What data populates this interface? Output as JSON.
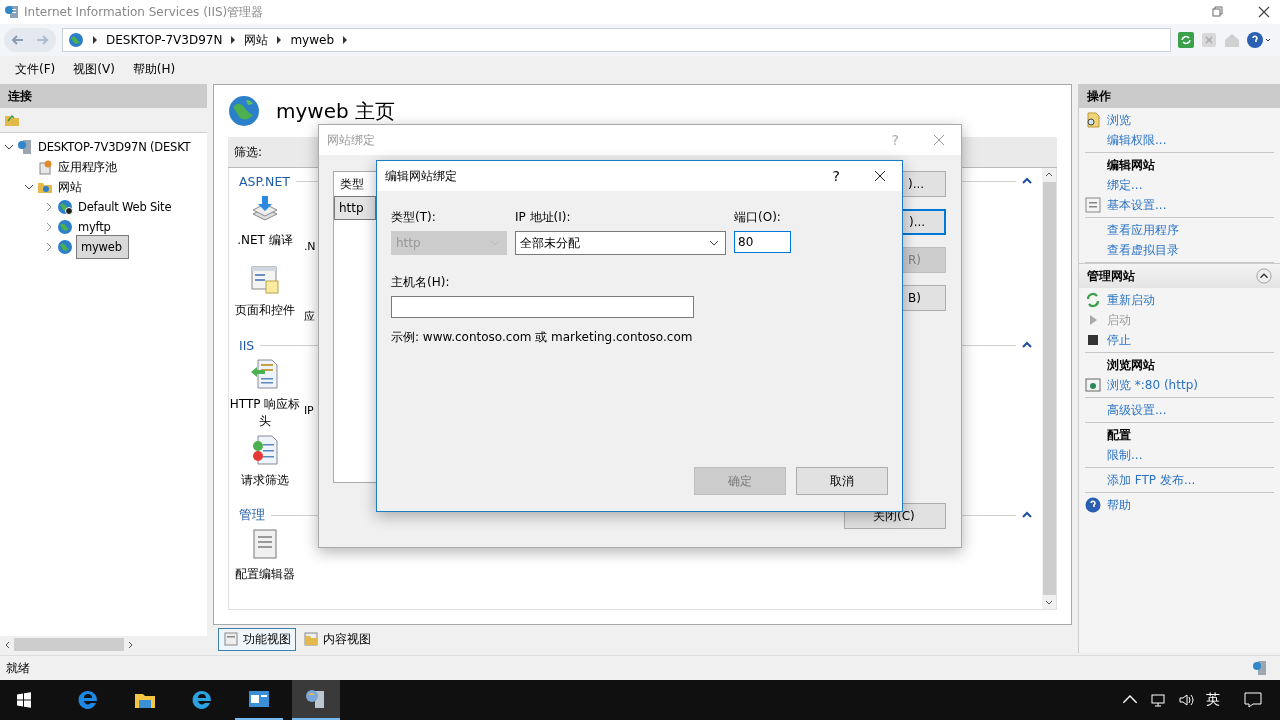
{
  "window": {
    "title": "Internet Information Services (IIS)管理器"
  },
  "address_bar": {
    "crumbs": [
      "DESKTOP-7V3D97N",
      "网站",
      "myweb"
    ]
  },
  "menu": [
    "文件(F)",
    "视图(V)",
    "帮助(H)"
  ],
  "connections": {
    "title": "连接",
    "tree": [
      {
        "label": "DESKTOP-7V3D97N (DESKT",
        "kind": "server",
        "expanded": true,
        "selected": false,
        "children": [
          {
            "label": "应用程序池",
            "kind": "pools",
            "selected": false
          },
          {
            "label": "网站",
            "kind": "sites",
            "expanded": true,
            "selected": false,
            "children": [
              {
                "label": "Default Web Site",
                "kind": "site",
                "stopped": true,
                "expanded": false,
                "selected": false
              },
              {
                "label": "myftp",
                "kind": "site",
                "stopped": false,
                "expanded": false,
                "selected": false
              },
              {
                "label": "myweb",
                "kind": "site",
                "stopped": false,
                "expanded": false,
                "selected": true
              }
            ]
          }
        ]
      }
    ]
  },
  "home": {
    "title": "myweb 主页",
    "filter_label": "筛选:",
    "groups": [
      {
        "title": "ASP.NET",
        "expanded": true,
        "rows": [
          [
            {
              "label": ".NET 编译",
              "kind": "compile"
            },
            {
              "label": ".N",
              "kind": "fragment"
            }
          ],
          [
            {
              "label": "页面和控件",
              "kind": "pages"
            },
            {
              "label": "应",
              "kind": "fragment"
            }
          ]
        ]
      },
      {
        "title": "IIS",
        "expanded": true,
        "rows": [
          [
            {
              "label": "HTTP 响应标头",
              "kind": "headers"
            },
            {
              "label": "IP",
              "kind": "fragment"
            }
          ],
          [
            {
              "label": "请求筛选",
              "kind": "filter"
            }
          ]
        ]
      },
      {
        "title": "管理",
        "expanded": true,
        "rows": [
          [
            {
              "label": "配置编辑器",
              "kind": "editor"
            }
          ]
        ]
      }
    ],
    "views": [
      {
        "label": "功能视图",
        "selected": true
      },
      {
        "label": "内容视图",
        "selected": false
      }
    ]
  },
  "actions": [
    {
      "title": "操作",
      "groups": [
        [
          {
            "label": "浏览",
            "kind": "link"
          },
          {
            "label": "编辑权限...",
            "kind": "link"
          }
        ],
        [
          {
            "label": "编辑网站",
            "kind": "heading"
          },
          {
            "label": "绑定...",
            "kind": "link"
          },
          {
            "label": "基本设置...",
            "kind": "link"
          }
        ],
        [
          {
            "label": "查看应用程序",
            "kind": "link"
          },
          {
            "label": "查看虚拟目录",
            "kind": "link"
          }
        ]
      ]
    },
    {
      "title": "管理网站",
      "expanded": true,
      "groups": [
        [
          {
            "label": "重新启动",
            "kind": "link"
          },
          {
            "label": "启动",
            "kind": "disabled"
          },
          {
            "label": "停止",
            "kind": "link"
          }
        ],
        [
          {
            "label": "浏览网站",
            "kind": "heading"
          },
          {
            "label": "浏览 *:80 (http)",
            "kind": "link"
          }
        ],
        [
          {
            "label": "高级设置...",
            "kind": "link"
          }
        ],
        [
          {
            "label": "配置",
            "kind": "heading"
          },
          {
            "label": "限制...",
            "kind": "link"
          }
        ],
        [
          {
            "label": "添加 FTP 发布...",
            "kind": "link"
          }
        ],
        [
          {
            "label": "帮助",
            "kind": "link"
          }
        ]
      ]
    }
  ],
  "status_bar": "就绪",
  "bindings_dialog": {
    "title": "网站绑定",
    "help": "?",
    "column": "类型",
    "rows": [
      {
        "type": "http",
        "selected": true
      }
    ],
    "buttons": [
      {
        "label": ")...",
        "disabled": false,
        "focused": false
      },
      {
        "label": ")...",
        "disabled": false,
        "focused": true
      },
      {
        "label": "R)",
        "disabled": true,
        "focused": false
      },
      {
        "label": "B)",
        "disabled": false,
        "focused": false
      }
    ],
    "close_button": "关闭(C)"
  },
  "edit_dialog": {
    "title": "编辑网站绑定",
    "help": "?",
    "type": {
      "label": "类型(T):",
      "value": "http",
      "disabled": true
    },
    "ip": {
      "label": "IP 地址(I):",
      "value": "全部未分配"
    },
    "port": {
      "label": "端口(O):",
      "value": "80",
      "focused": true
    },
    "host": {
      "label": "主机名(H):"
    },
    "example": "示例: www.contoso.com 或 marketing.contoso.com",
    "buttons": [
      {
        "label": "确定",
        "disabled": true
      },
      {
        "label": "取消",
        "disabled": false
      }
    ]
  },
  "taskbar": {
    "apps": [
      {
        "kind": "edge",
        "active": false,
        "running": false
      },
      {
        "kind": "explorer",
        "active": false,
        "running": false
      },
      {
        "kind": "ie",
        "active": false,
        "running": false
      },
      {
        "kind": "window",
        "active": false,
        "running": true
      },
      {
        "kind": "iis",
        "active": true,
        "running": true
      }
    ],
    "ime": "英"
  }
}
